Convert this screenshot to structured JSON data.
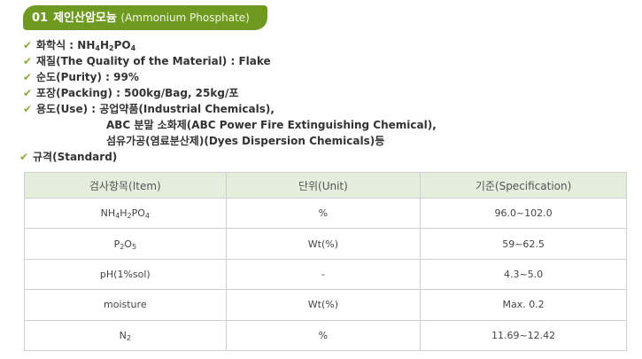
{
  "title": {
    "number": "01",
    "korean": "제인산암모늄",
    "english": "(Ammonium Phosphate)"
  },
  "formula": {
    "label": "화학식 : ",
    "parts": [
      "NH",
      "4",
      "H",
      "2",
      "PO",
      "4"
    ]
  },
  "material": "재질(The Quality of the Material) : Flake",
  "purity": "순도(Purity) : 99%",
  "packing": "포장(Packing) : 500kg/Bag, 25kg/포",
  "use": {
    "line1": "용도(Use) : 공업약품(Industrial Chemicals),",
    "line2": "ABC 분말 소화제(ABC Power Fire Extinguishing Chemical),",
    "line3": "섬유가공(염료분산제)(Dyes Dispersion Chemicals)등"
  },
  "standard": "규격(Standard)",
  "table": {
    "headers": [
      "검사항목(Item)",
      "단위(Unit)",
      "기준(Specification)"
    ],
    "rows": [
      {
        "item": [
          "NH",
          "4",
          "H",
          "2",
          "PO",
          "4"
        ],
        "unit": "%",
        "spec": "96.0~102.0"
      },
      {
        "item": [
          "P",
          "2",
          "O",
          "5"
        ],
        "unit": "Wt(%)",
        "spec": "59~62.5"
      },
      {
        "item": [
          "pH(1%sol)"
        ],
        "unit": "-",
        "spec": "4.3~5.0"
      },
      {
        "item": [
          "moisture"
        ],
        "unit": "Wt(%)",
        "spec": "Max. 0.2"
      },
      {
        "item": [
          "N",
          "2"
        ],
        "unit": "%",
        "spec": "11.69~12.42"
      }
    ]
  }
}
